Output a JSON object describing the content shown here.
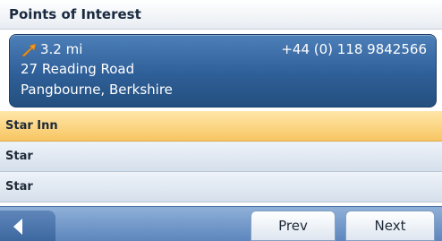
{
  "header": {
    "title": "Points of Interest"
  },
  "detail": {
    "distance": "3.2 mi",
    "phone": "+44 (0) 118 9842566",
    "address_line1": "27 Reading Road",
    "address_line2": "Pangbourne, Berkshire",
    "direction_icon": "direction-arrow-icon"
  },
  "results": [
    {
      "name": "Star Inn",
      "selected": true
    },
    {
      "name": "Star",
      "selected": false
    },
    {
      "name": "Star",
      "selected": false
    }
  ],
  "toolbar": {
    "back_icon": "back-arrow-icon",
    "prev_label": "Prev",
    "next_label": "Next"
  },
  "colors": {
    "card": "#2f5f98",
    "selected_row": "#f7c663",
    "toolbar": "#5d86bd",
    "arrow": "#f39a1e"
  }
}
